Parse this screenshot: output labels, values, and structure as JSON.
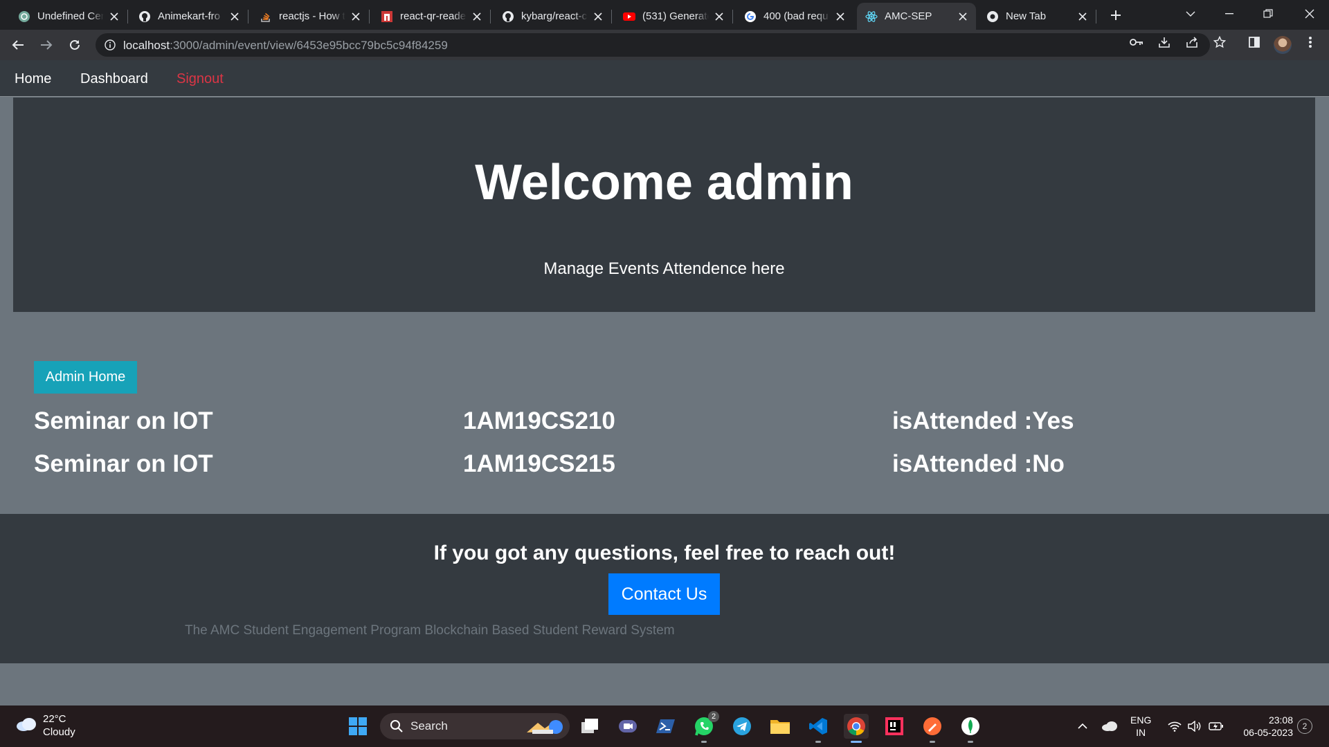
{
  "browser": {
    "tabs": [
      {
        "title": "Undefined Cer",
        "icon": "chatgpt-icon"
      },
      {
        "title": "Animekart-fro",
        "icon": "github-icon"
      },
      {
        "title": "reactjs - How t",
        "icon": "stackoverflow-icon"
      },
      {
        "title": "react-qr-reade",
        "icon": "npm-icon"
      },
      {
        "title": "kybarg/react-c",
        "icon": "github-icon"
      },
      {
        "title": "(531) Generate",
        "icon": "youtube-icon"
      },
      {
        "title": "400 (bad requ",
        "icon": "google-icon"
      },
      {
        "title": "AMC-SEP",
        "icon": "react-icon",
        "active": true
      },
      {
        "title": "New Tab",
        "icon": "chrome-icon"
      }
    ],
    "url_host": "localhost",
    "url_path": ":3000/admin/event/view/6453e95bcc79bc5c94f84259"
  },
  "navbar": {
    "home": "Home",
    "dashboard": "Dashboard",
    "signout": "Signout"
  },
  "jumbotron": {
    "title": "Welcome admin",
    "subtitle": "Manage Events Attendence here"
  },
  "admin_home_label": "Admin Home",
  "attendance": [
    {
      "event": "Seminar on IOT",
      "usn": "1AM19CS210",
      "status": "isAttended :Yes"
    },
    {
      "event": "Seminar on IOT",
      "usn": "1AM19CS215",
      "status": "isAttended :No"
    }
  ],
  "footer": {
    "question": "If you got any questions, feel free to reach out!",
    "contact_label": "Contact Us",
    "tagline": "The AMC Student Engagement Program Blockchain Based Student Reward System"
  },
  "taskbar": {
    "weather_temp": "22°C",
    "weather_desc": "Cloudy",
    "search_label": "Search",
    "whatsapp_badge": "2",
    "lang_top": "ENG",
    "lang_bottom": "IN",
    "time": "23:08",
    "date": "06-05-2023",
    "notifications": "2"
  },
  "colors": {
    "navbar_bg": "#343a40",
    "page_bg": "#6c757d",
    "signout": "#dc3545",
    "admin_home_btn": "#17a2b8",
    "contact_btn": "#007bff"
  }
}
